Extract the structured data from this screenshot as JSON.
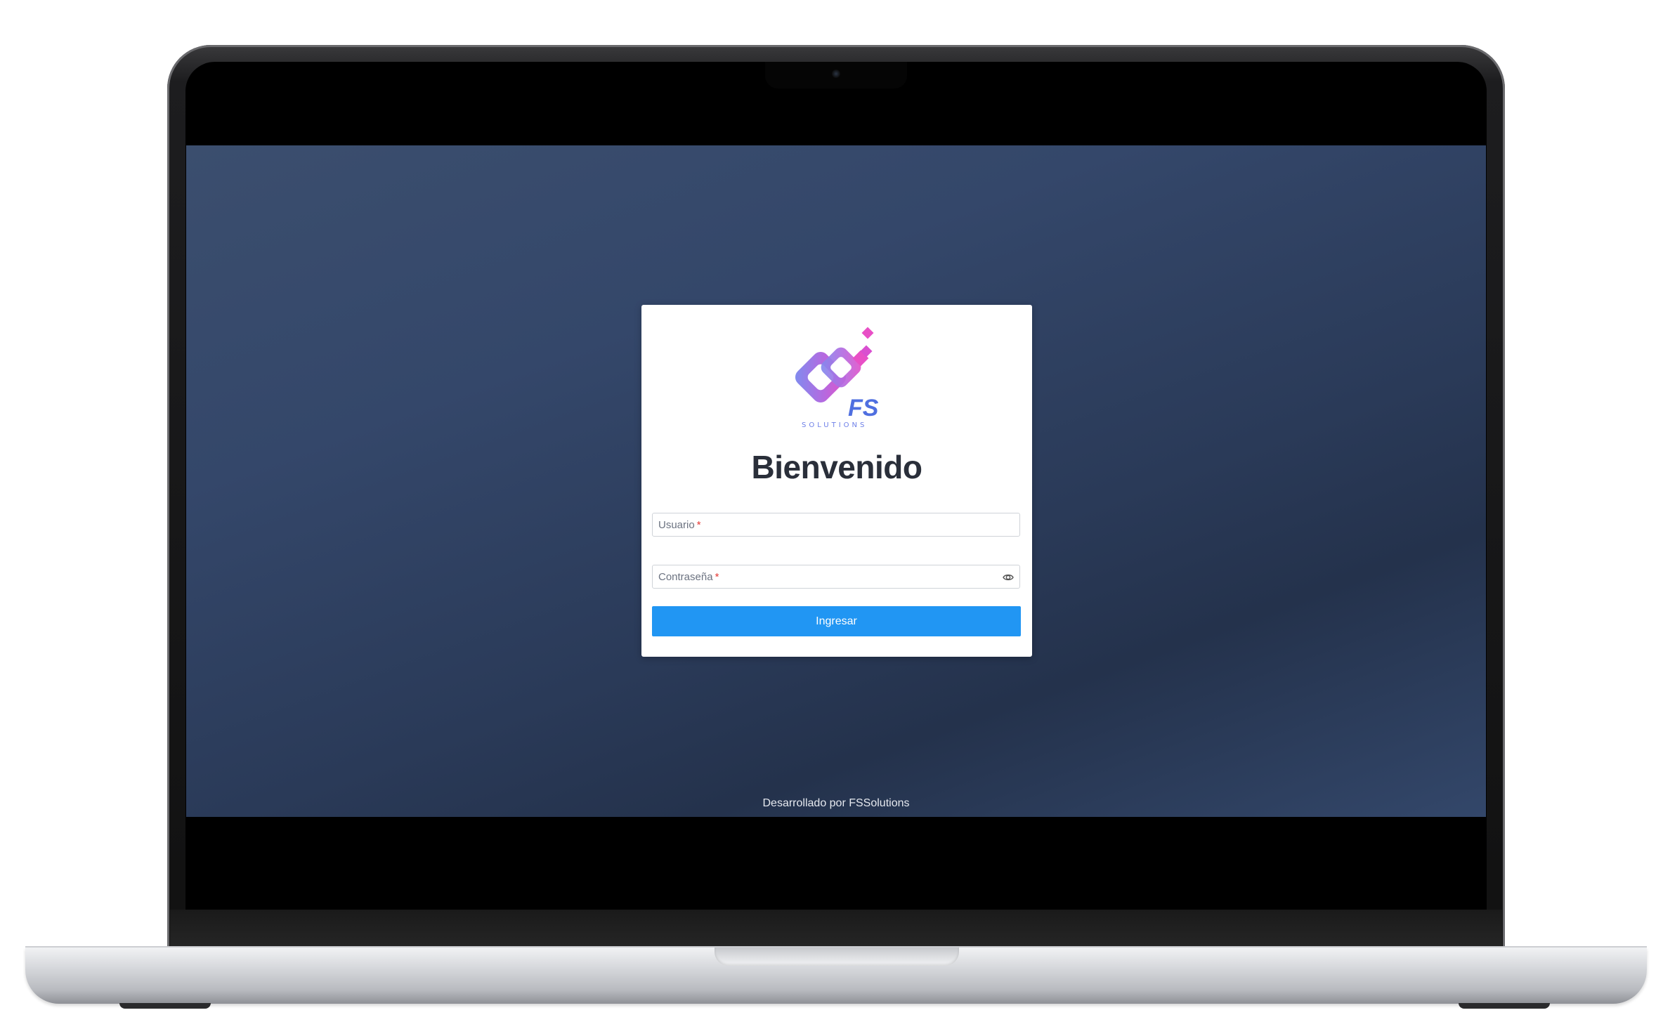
{
  "login": {
    "logo": {
      "brand_letters": "FS",
      "brand_subtitle": "SOLUTIONS"
    },
    "title": "Bienvenido",
    "username_field": {
      "label": "Usuario",
      "required_mark": "*",
      "value": ""
    },
    "password_field": {
      "label": "Contraseña",
      "required_mark": "*",
      "value": "",
      "toggle_icon": "eye-icon"
    },
    "submit_label": "Ingresar"
  },
  "footer": {
    "text": "Desarrollado por FSSolutions"
  },
  "colors": {
    "primary_button": "#2196f3",
    "background": "#34476a",
    "required": "#e53935",
    "logo_gradient_start": "#7b8ff0",
    "logo_gradient_end": "#e84fc6"
  }
}
